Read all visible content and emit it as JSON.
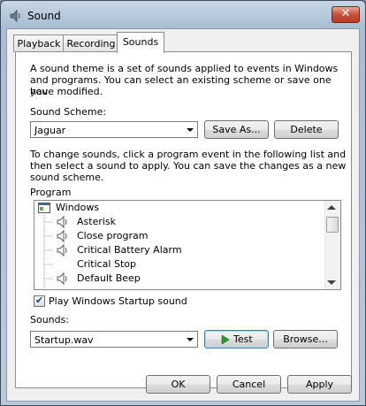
{
  "window": {
    "title": "Sound",
    "close_glyph": "✕"
  },
  "tabs": [
    {
      "label": "Playback"
    },
    {
      "label": "Recording"
    },
    {
      "label": "Sounds",
      "active": true
    }
  ],
  "intro_lines": [
    "A sound theme is a set of sounds applied to events in Windows",
    "and programs.  You can select an existing scheme or save one you",
    "have modified."
  ],
  "scheme": {
    "label": "Sound Scheme:",
    "value": "Jaguar",
    "save_as_label": "Save As...",
    "delete_label": "Delete"
  },
  "instructions_lines": [
    "To change sounds, click a program event in the following list and",
    "then select a sound to apply.  You can save the changes as a new",
    "sound scheme."
  ],
  "program": {
    "label": "Program",
    "items": [
      {
        "label": "Windows",
        "icon": "windows-icon"
      },
      {
        "label": "Asterisk",
        "icon": "speaker-icon"
      },
      {
        "label": "Close program",
        "icon": "speaker-icon"
      },
      {
        "label": "Critical Battery Alarm",
        "icon": "speaker-icon"
      },
      {
        "label": "Critical Stop",
        "icon": ""
      },
      {
        "label": "Default Beep",
        "icon": "speaker-icon"
      }
    ]
  },
  "startup": {
    "label": "Play Windows Startup sound",
    "checked": true,
    "check_glyph": "✔"
  },
  "sounds": {
    "label": "Sounds:",
    "value": "Startup.wav",
    "test_label": "Test",
    "browse_label": "Browse..."
  },
  "footer": {
    "ok_label": "OK",
    "cancel_label": "Cancel",
    "apply_label": "Apply"
  }
}
